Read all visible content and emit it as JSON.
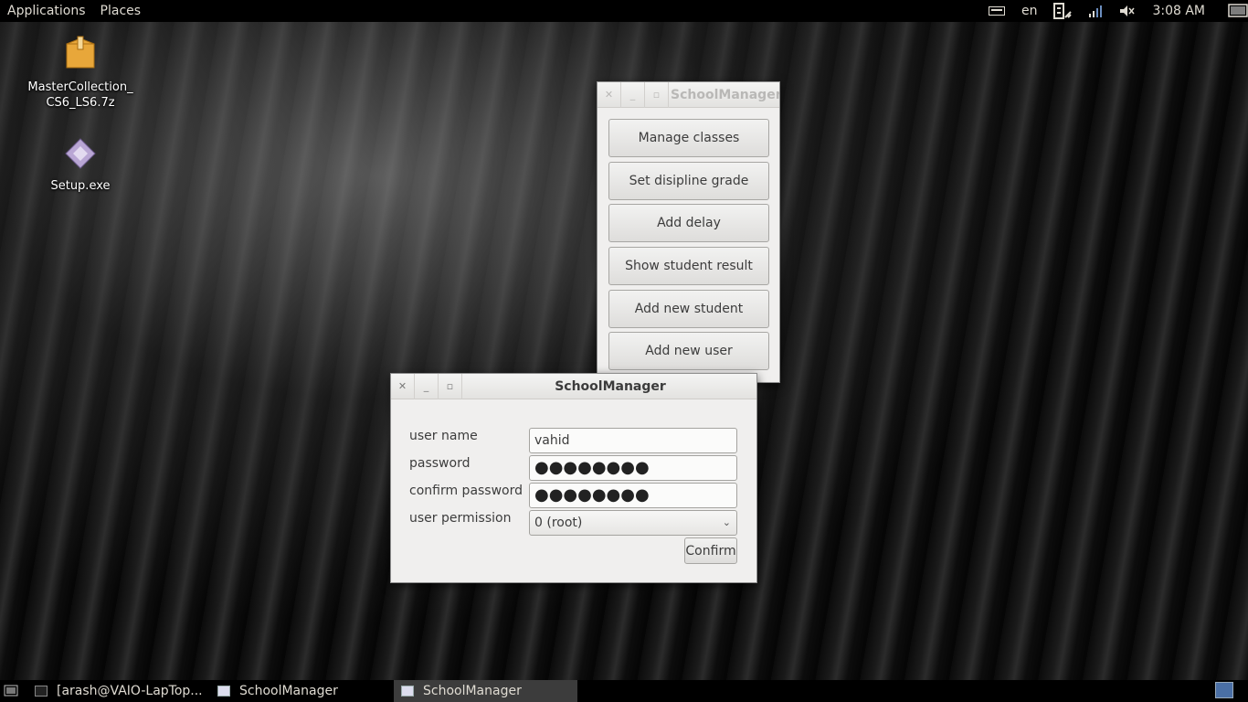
{
  "top_panel": {
    "menus": [
      "Applications",
      "Places"
    ],
    "keyboard_layout": "en",
    "clock": "3:08 AM"
  },
  "desktop": {
    "icons": [
      {
        "label": "MasterCollection_\nCS6_LS6.7z",
        "icon": "archive-icon"
      },
      {
        "label": "Setup.exe",
        "icon": "executable-icon"
      }
    ]
  },
  "main_window": {
    "title": "SchoolManager",
    "buttons": [
      "Manage classes",
      "Set disipline grade",
      "Add delay",
      "Show student result",
      "Add new student",
      "Add new user"
    ]
  },
  "dialog": {
    "title": "SchoolManager",
    "labels": {
      "username": "user name",
      "password": "password",
      "confirm_password": "confirm password",
      "permission": "user permission"
    },
    "values": {
      "username": "vahid",
      "password": "●●●●●●●●",
      "confirm_password": "●●●●●●●●",
      "permission": "0 (root)"
    },
    "confirm_label": "Confirm"
  },
  "taskbar": {
    "tasks": [
      {
        "label": "[arash@VAIO-LapTop...",
        "icon": "terminal-icon",
        "active": false
      },
      {
        "label": "SchoolManager",
        "icon": "window-icon",
        "active": false
      },
      {
        "label": "SchoolManager",
        "icon": "window-icon",
        "active": true
      }
    ]
  }
}
